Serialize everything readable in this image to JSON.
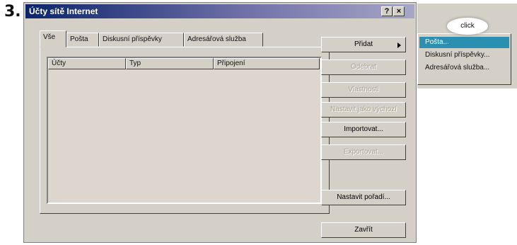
{
  "step_number": "3.",
  "window": {
    "title": "Účty sítě Internet",
    "help_glyph": "?",
    "close_glyph": "×"
  },
  "tabs": [
    {
      "label": "Vše",
      "active": true
    },
    {
      "label": "Pošta",
      "active": false
    },
    {
      "label": "Diskusní příspěvky",
      "active": false
    },
    {
      "label": "Adresářová služba",
      "active": false
    }
  ],
  "list": {
    "columns": [
      "Účty",
      "Typ",
      "Připojení"
    ]
  },
  "buttons": {
    "add": "Přidat",
    "remove": "Odebrat",
    "properties": "Vlastnosti",
    "set_default": "Nastavit jako výchozí",
    "import": "Importovat...",
    "export": "Exportovat...",
    "set_order": "Nastavit pořadí...",
    "close": "Zavřít"
  },
  "menu": {
    "items": [
      "Pošta...",
      "Diskusní příspěvky...",
      "Adresářová služba..."
    ]
  },
  "annotation": {
    "callout": "click"
  },
  "colors": {
    "titlebar": "#0a246a",
    "highlight": "#2a8fb0",
    "face": "#d4d0c8"
  }
}
